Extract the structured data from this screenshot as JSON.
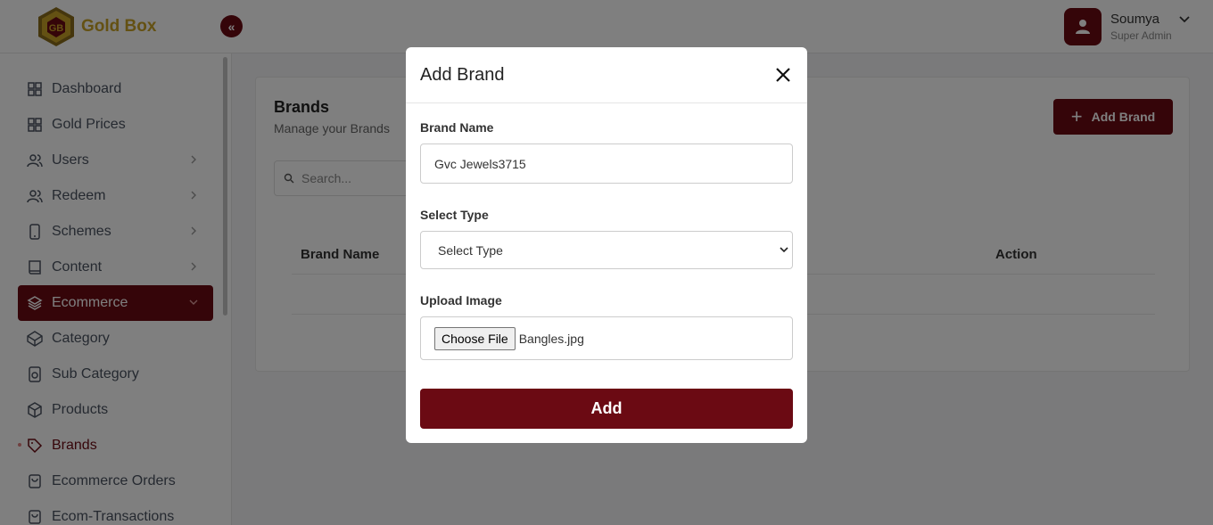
{
  "header": {
    "app_name": "Gold Box",
    "collapse_glyph": "«",
    "user_name": "Soumya",
    "user_role": "Super Admin"
  },
  "sidebar": {
    "items": [
      {
        "label": "Dashboard",
        "icon": "grid-icon"
      },
      {
        "label": "Gold Prices",
        "icon": "grid-icon"
      },
      {
        "label": "Users",
        "icon": "users-icon",
        "has_arrow": true
      },
      {
        "label": "Redeem",
        "icon": "users-icon",
        "has_arrow": true
      },
      {
        "label": "Schemes",
        "icon": "tablet-icon",
        "has_arrow": true
      },
      {
        "label": "Content",
        "icon": "book-icon",
        "has_arrow": true
      },
      {
        "label": "Ecommerce",
        "icon": "layers-icon",
        "active": true
      },
      {
        "label": "Category",
        "icon": "codepen-icon"
      },
      {
        "label": "Sub Category",
        "icon": "disc-icon"
      },
      {
        "label": "Products",
        "icon": "box-icon"
      },
      {
        "label": "Brands",
        "icon": "tag-icon",
        "current": true
      },
      {
        "label": "Ecommerce Orders",
        "icon": "bag-icon"
      },
      {
        "label": "Ecom-Transactions",
        "icon": "bag-icon"
      }
    ]
  },
  "main": {
    "title": "Brands",
    "subtitle": "Manage your Brands",
    "add_button_label": "Add Brand",
    "add_button_glyph": "+",
    "search_placeholder": "Search...",
    "table_headers": [
      "Brand Name",
      "Action"
    ]
  },
  "modal": {
    "title": "Add Brand",
    "brand_name_label": "Brand Name",
    "brand_name_value": "Gvc Jewels3715",
    "select_type_label": "Select Type",
    "select_type_value": "Select Type",
    "upload_label": "Upload Image",
    "choose_file_label": "Choose File",
    "file_name": "Bangles.jpg",
    "submit_label": "Add"
  },
  "colors": {
    "brand_primary": "#6b0a13",
    "logo_gold": "#c9a227"
  }
}
